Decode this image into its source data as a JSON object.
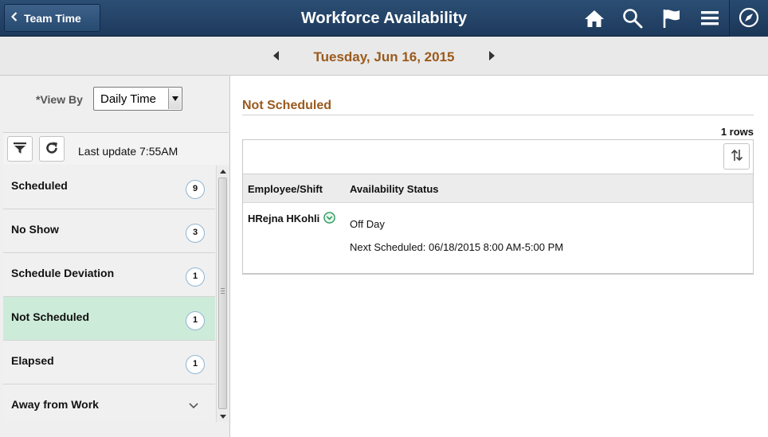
{
  "header": {
    "back_label": "Team Time",
    "title": "Workforce Availability",
    "icons": [
      "home-icon",
      "search-icon",
      "flag-icon",
      "menu-icon",
      "navigator-icon"
    ],
    "color": "#1d3a5c"
  },
  "datebar": {
    "date": "Tuesday, Jun 16, 2015",
    "date_color": "#9a5a1d"
  },
  "left": {
    "view_by_label": "*View By",
    "view_by_value": "Daily Time",
    "last_update": "Last update 7:55AM",
    "items": [
      {
        "label": "Scheduled",
        "count": "9"
      },
      {
        "label": "No Show",
        "count": "3"
      },
      {
        "label": "Schedule Deviation",
        "count": "1"
      },
      {
        "label": "Not Scheduled",
        "count": "1",
        "selected": true
      },
      {
        "label": "Elapsed",
        "count": "1"
      },
      {
        "label": "Away from Work",
        "count": ""
      }
    ],
    "selected_color": "#cdebd9"
  },
  "main": {
    "section_title": "Not Scheduled",
    "rows_count": "1 rows",
    "columns": [
      "Employee/Shift",
      "Availability Status"
    ],
    "rows": [
      {
        "employee": "HRejna HKohli",
        "status": "Off Day",
        "next_scheduled": "Next Scheduled: 06/18/2015 8:00 AM-5:00 PM"
      }
    ]
  }
}
